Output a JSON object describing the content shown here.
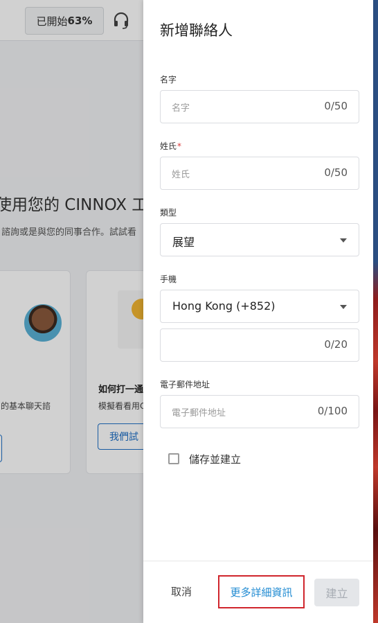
{
  "background": {
    "progress": {
      "label": "已開始",
      "percent": "63%"
    },
    "welcome_title": "使用您的 CINNOX 工",
    "welcome_subtitle": "諮詢或是與您的同事合作。試試看",
    "card1": {
      "text": "的基本聊天諮"
    },
    "card2": {
      "title": "如何打一通",
      "text": "模擬看看用C",
      "button": "我們試"
    }
  },
  "drawer": {
    "title": "新增聯絡人",
    "fields": {
      "first_name": {
        "label": "名字",
        "placeholder": "名字",
        "counter": "0/50"
      },
      "last_name": {
        "label": "姓氏",
        "required_mark": "*",
        "placeholder": "姓氏",
        "counter": "0/50"
      },
      "type": {
        "label": "類型",
        "value": "展望"
      },
      "mobile": {
        "label": "手機",
        "country": "Hong Kong (+852)",
        "counter": "0/20"
      },
      "email": {
        "label": "電子郵件地址",
        "placeholder": "電子郵件地址",
        "counter": "0/100"
      }
    },
    "save_and_create": {
      "label": "儲存並建立",
      "checked": false
    },
    "footer": {
      "cancel": "取消",
      "more_details": "更多詳細資訊",
      "create": "建立"
    }
  },
  "colors": {
    "accent_link": "#1f8ad2",
    "highlight_border": "#d0252c",
    "required": "#d93a3a"
  }
}
